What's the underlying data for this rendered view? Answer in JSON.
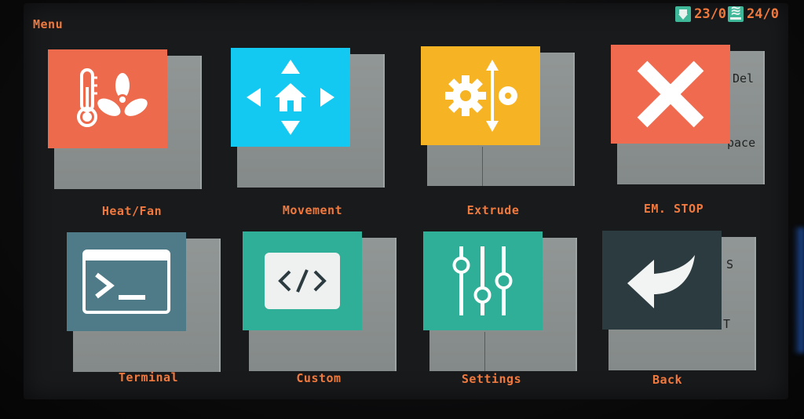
{
  "header": {
    "title": "Menu",
    "nozzle_temp": "23/0",
    "bed_temp": "24/0"
  },
  "tiles": [
    {
      "id": "heat-fan",
      "label": "Heat/Fan",
      "color": "#ee6a4c",
      "icon": "thermometer-fan-icon"
    },
    {
      "id": "movement",
      "label": "Movement",
      "color": "#14c9f1",
      "icon": "move-arrows-icon"
    },
    {
      "id": "extrude",
      "label": "Extrude",
      "color": "#f6b324",
      "icon": "extruder-gear-icon"
    },
    {
      "id": "em-stop",
      "label": "EM. STOP",
      "color": "#ef6a4e",
      "icon": "close-x-icon"
    },
    {
      "id": "terminal",
      "label": "Terminal",
      "color": "#4f7a88",
      "icon": "terminal-icon"
    },
    {
      "id": "custom",
      "label": "Custom",
      "color": "#2fae98",
      "icon": "code-icon"
    },
    {
      "id": "settings",
      "label": "Settings",
      "color": "#2fae98",
      "icon": "sliders-icon"
    },
    {
      "id": "back",
      "label": "Back",
      "color": "#2c3b40",
      "icon": "back-arrow-icon"
    }
  ],
  "bleed_text": {
    "del": "Del",
    "pace": "pace",
    "s": "S",
    "t": "T"
  },
  "colors": {
    "accent": "#f0793e",
    "status_icon": "#3fb89a",
    "tile_back": "#8b9190"
  }
}
